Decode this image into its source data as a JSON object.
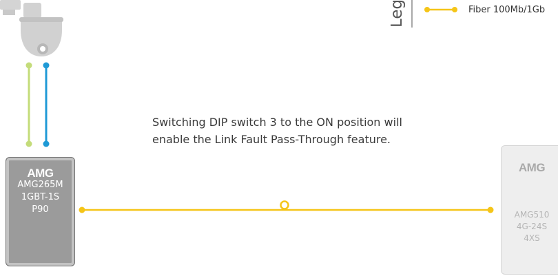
{
  "legend": {
    "title": "Legend",
    "items": [
      {
        "label": "Fiber 100Mb/1Gb",
        "color": "#f5c518"
      }
    ]
  },
  "note": "Switching DIP switch 3 to the ON position will enable the Link Fault Pass-Through feature.",
  "devices": {
    "camera": {
      "icon": "ptz-dome-camera-icon"
    },
    "left": {
      "brand": "AMG",
      "model_lines": [
        "AMG265M",
        "1GBT-1S",
        "P90"
      ]
    },
    "right": {
      "brand": "AMG",
      "model_lines": [
        "AMG510",
        "4G-24S",
        "4XS"
      ]
    }
  },
  "colors": {
    "fiber": "#f5c518",
    "copper_a": "#c4dc7a",
    "copper_b": "#1f9ad6"
  }
}
